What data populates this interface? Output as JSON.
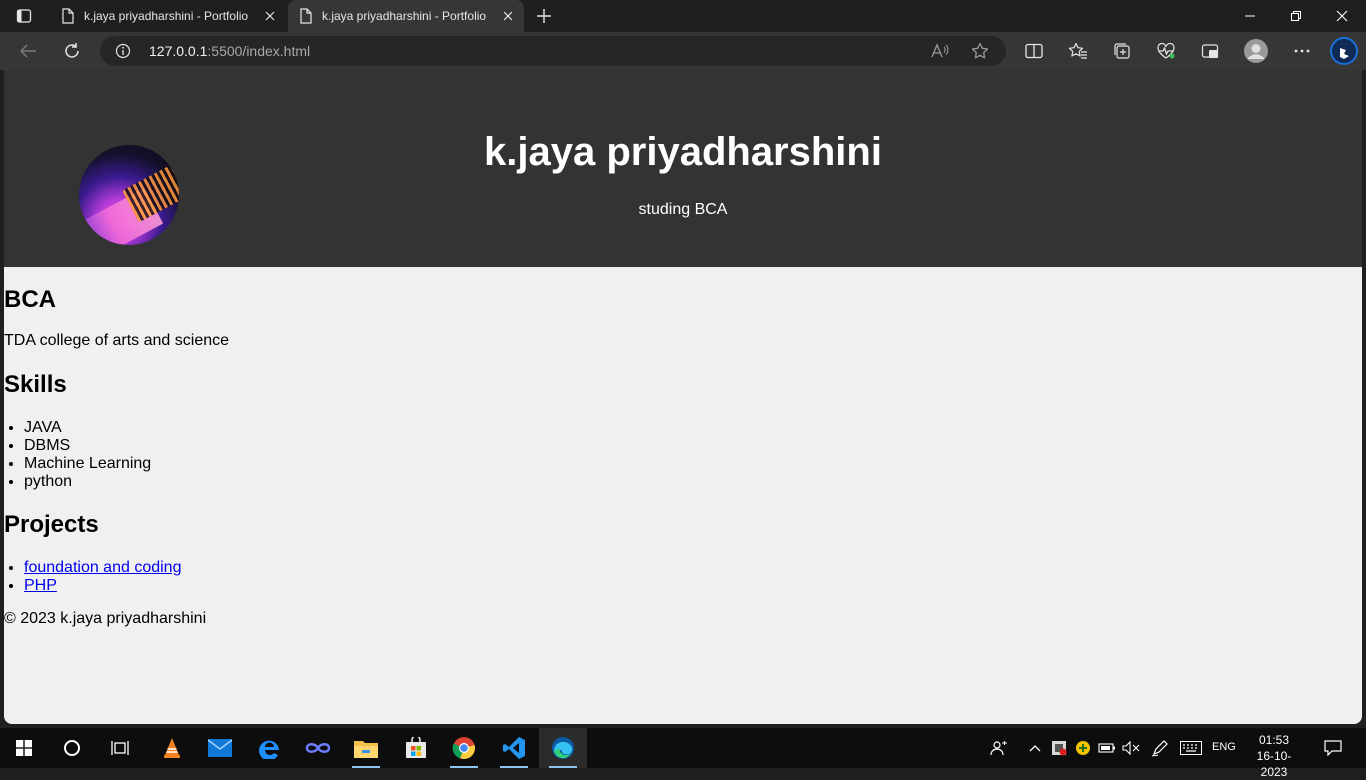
{
  "browser": {
    "tabs": [
      {
        "title": "k.jaya priyadharshini - Portfolio",
        "active": false
      },
      {
        "title": "k.jaya priyadharshini - Portfolio",
        "active": true
      }
    ],
    "address": {
      "host": "127.0.0.1",
      "rest": ":5500/index.html"
    }
  },
  "page": {
    "header": {
      "name": "k.jaya priyadharshini",
      "subtitle": "studing BCA"
    },
    "education": {
      "heading": "BCA",
      "college": "TDA college of arts and science"
    },
    "skills": {
      "heading": "Skills",
      "items": [
        "JAVA",
        "DBMS",
        "Machine Learning",
        "python"
      ]
    },
    "projects": {
      "heading": "Projects",
      "items": [
        "foundation and coding",
        "PHP"
      ]
    },
    "footer": "© 2023 k.jaya priyadharshini"
  },
  "taskbar": {
    "apps": [
      "windows-start",
      "search",
      "task-view",
      "vlc",
      "mail",
      "edge-legacy",
      "infinity-app",
      "file-explorer",
      "microsoft-store",
      "chrome",
      "vscode",
      "edge"
    ],
    "lang": "ENG",
    "time": "01:53",
    "date": "16-10-2023"
  },
  "colors": {
    "header_bg": "#333333",
    "page_bg": "#f0f0f0",
    "link": "#0000ee",
    "taskbar_active_underline": "#8fc3ef"
  }
}
